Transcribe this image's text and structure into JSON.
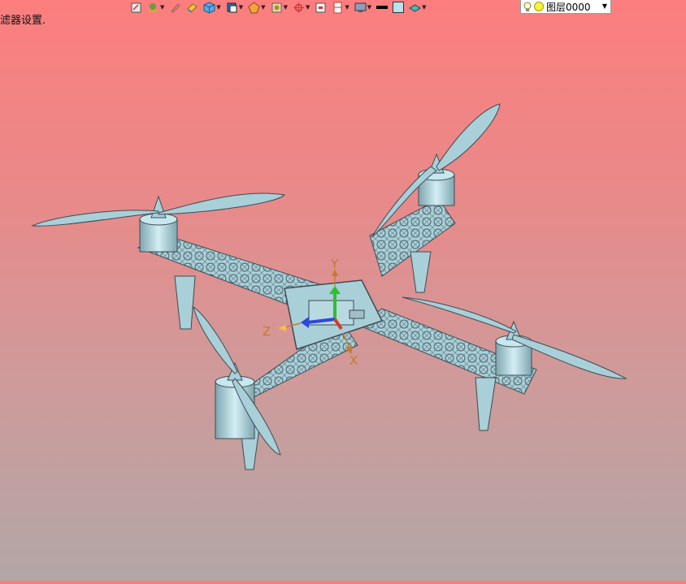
{
  "status": {
    "text": "滤器设置."
  },
  "toolbar": {
    "icons": [
      "sketch-icon",
      "tag-icon",
      "pencil-icon",
      "eraser-icon",
      "cube-icon",
      "view-cube-icon",
      "render-mode-icon",
      "section-icon",
      "snap-icon",
      "datum-icon",
      "frame-icon",
      "display-icon"
    ]
  },
  "style": {
    "line_color": "#000000",
    "fill_color": "#b9e3ef"
  },
  "layer": {
    "label": "图层0000"
  },
  "axes": {
    "x": "X",
    "y": "Y",
    "z": "Z"
  },
  "colors": {
    "model": "#a9cfd8",
    "model_edge": "#3c4c52",
    "axis_x": "#d23a2a",
    "axis_y": "#2fbf2f",
    "axis_z": "#2f47d8",
    "axis_label": "#c8792a"
  }
}
